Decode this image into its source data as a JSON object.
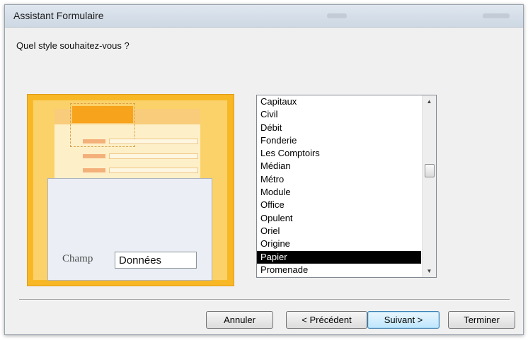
{
  "window": {
    "title": "Assistant Formulaire"
  },
  "question": "Quel style souhaitez-vous ?",
  "preview": {
    "label": "Champ",
    "value": "Données"
  },
  "style_list": {
    "items": [
      "Capitaux",
      "Civil",
      "Débit",
      "Fonderie",
      "Les Comptoirs",
      "Médian",
      "Métro",
      "Module",
      "Office",
      "Opulent",
      "Oriel",
      "Origine",
      "Papier",
      "Promenade"
    ],
    "selected": "Papier"
  },
  "buttons": {
    "cancel": "Annuler",
    "previous": "< Précédent",
    "next": "Suivant >",
    "finish": "Terminer"
  },
  "colors": {
    "selection": "#000000",
    "preview_accent": "#f8b826",
    "default_button_border": "#3c7fb1"
  },
  "icons": {
    "scroll_up": "scroll-up-arrow-icon",
    "scroll_down": "scroll-down-arrow-icon"
  }
}
